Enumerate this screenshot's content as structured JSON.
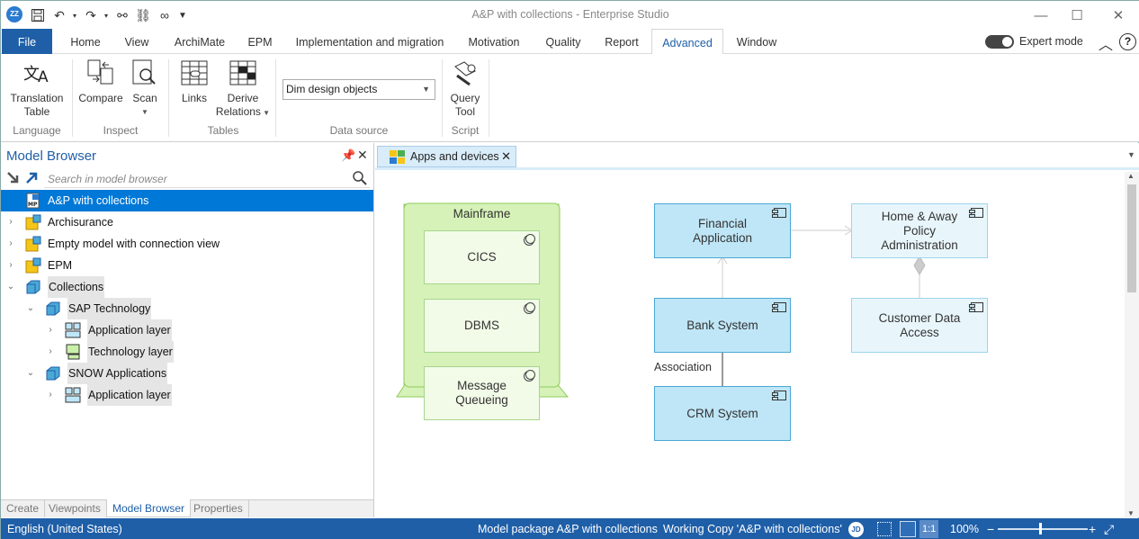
{
  "window": {
    "title": "A&P with collections - Enterprise Studio",
    "app_icon": "ZZ"
  },
  "menu": {
    "tabs": [
      "File",
      "Home",
      "View",
      "ArchiMate",
      "EPM",
      "Implementation and migration",
      "Motivation",
      "Quality",
      "Report",
      "Advanced",
      "Window"
    ],
    "active": "Advanced",
    "expert_mode_label": "Expert mode"
  },
  "ribbon": {
    "language": {
      "btn": "Translation Table",
      "btn_l1": "Translation",
      "btn_l2": "Table",
      "group": "Language"
    },
    "inspect": {
      "compare": "Compare",
      "scan": "Scan",
      "group": "Inspect"
    },
    "tables": {
      "links": "Links",
      "derive_l1": "Derive",
      "derive_l2": "Relations",
      "group": "Tables"
    },
    "datasource": {
      "selected": "Dim design objects",
      "group": "Data source"
    },
    "script": {
      "btn_l1": "Query",
      "btn_l2": "Tool",
      "group": "Script"
    }
  },
  "browser": {
    "title": "Model Browser",
    "search_placeholder": "Search in model browser",
    "tree": [
      {
        "label": "A&P with collections",
        "level": 0,
        "chevron": "",
        "selected": true,
        "icon": "model-package-icon"
      },
      {
        "label": "Archisurance",
        "level": 0,
        "chevron": "›",
        "icon": "model-icon"
      },
      {
        "label": "Empty model with connection view",
        "level": 0,
        "chevron": "›",
        "icon": "model-icon"
      },
      {
        "label": "EPM",
        "level": 0,
        "chevron": "›",
        "icon": "model-icon"
      },
      {
        "label": "Collections",
        "level": 0,
        "chevron": "⌄",
        "icon": "collection-icon",
        "hl": true
      },
      {
        "label": "SAP Technology",
        "level": 1,
        "chevron": "⌄",
        "icon": "collection-icon",
        "hl": true
      },
      {
        "label": "Application layer",
        "level": 2,
        "chevron": "›",
        "icon": "app-layer-icon",
        "hl": true
      },
      {
        "label": "Technology layer",
        "level": 2,
        "chevron": "›",
        "icon": "tech-layer-icon",
        "hl": true
      },
      {
        "label": "SNOW Applications",
        "level": 1,
        "chevron": "⌄",
        "icon": "collection-icon",
        "hl": true
      },
      {
        "label": "Application layer",
        "level": 2,
        "chevron": "›",
        "icon": "app-layer-icon",
        "hl": true
      }
    ],
    "bottom_tabs": [
      "Create",
      "Viewpoints",
      "Model Browser",
      "Properties"
    ],
    "bottom_active": "Model Browser"
  },
  "diagram": {
    "tab_label": "Apps and devices",
    "mainframe": "Mainframe",
    "cics": "CICS",
    "dbms": "DBMS",
    "mq": "Message Queueing",
    "financial": "Financial Application",
    "homeaway": "Home & Away Policy Administration",
    "bank": "Bank System",
    "customer": "Customer Data Access",
    "crm": "CRM System",
    "association": "Association"
  },
  "status": {
    "language": "English (United States)",
    "package": "Model package A&P with collections",
    "working_copy": "Working Copy 'A&P with collections'",
    "user": "JD",
    "ratio": "1:1",
    "zoom": "100%"
  }
}
